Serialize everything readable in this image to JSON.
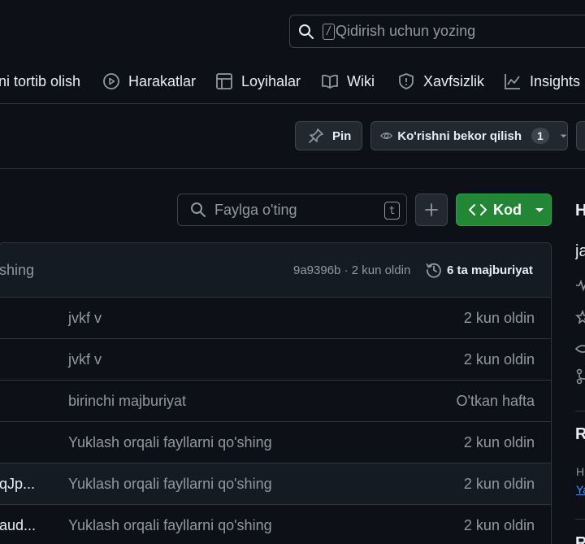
{
  "search": {
    "placeholder": "Qidirish uchun yozing",
    "key": "/"
  },
  "nav": {
    "items": [
      {
        "label": "ni tortib olish",
        "icon": "pull-request-icon"
      },
      {
        "label": "Harakatlar",
        "icon": "play-icon"
      },
      {
        "label": "Loyihalar",
        "icon": "table-icon"
      },
      {
        "label": "Wiki",
        "icon": "book-icon"
      },
      {
        "label": "Xavfsizlik",
        "icon": "shield-icon"
      },
      {
        "label": "Insights",
        "icon": "graph-icon"
      }
    ]
  },
  "actions": {
    "pin_label": "Pin",
    "watch_label": "Ko'rishni bekor qilish",
    "watch_count": "1"
  },
  "file_search": {
    "placeholder": "Faylga o'ting",
    "key": "t"
  },
  "code_button": {
    "label": "Kod"
  },
  "commit_header": {
    "message": "shing",
    "hash_time": "9a9396b · 2 kun oldin",
    "commits_label": "6 ta majburiyat"
  },
  "files": [
    {
      "name": "",
      "message": "jvkf v",
      "time": "2 kun oldin"
    },
    {
      "name": "",
      "message": "jvkf v",
      "time": "2 kun oldin"
    },
    {
      "name": "",
      "message": "birinchi majburiyat",
      "time": "O'tkan hafta"
    },
    {
      "name": "",
      "message": "Yuklash orqali fayllarni qo'shing",
      "time": "2 kun oldin"
    },
    {
      "name": "qJp...",
      "message": "Yuklash orqali fayllarni qo'shing",
      "time": "2 kun oldin"
    },
    {
      "name": "aud...",
      "message": "Yuklash orqali fayllarni qo'shing",
      "time": "2 kun oldin"
    }
  ],
  "sidebar": {
    "h": "H",
    "ja": "ja",
    "r": "R",
    "h2": "H",
    "ya": "Ya",
    "r2": "R"
  },
  "colors": {
    "bg": "#0d1117",
    "border": "#30363d",
    "green": "#238636",
    "muted": "#9198a1",
    "link": "#4493f8"
  }
}
